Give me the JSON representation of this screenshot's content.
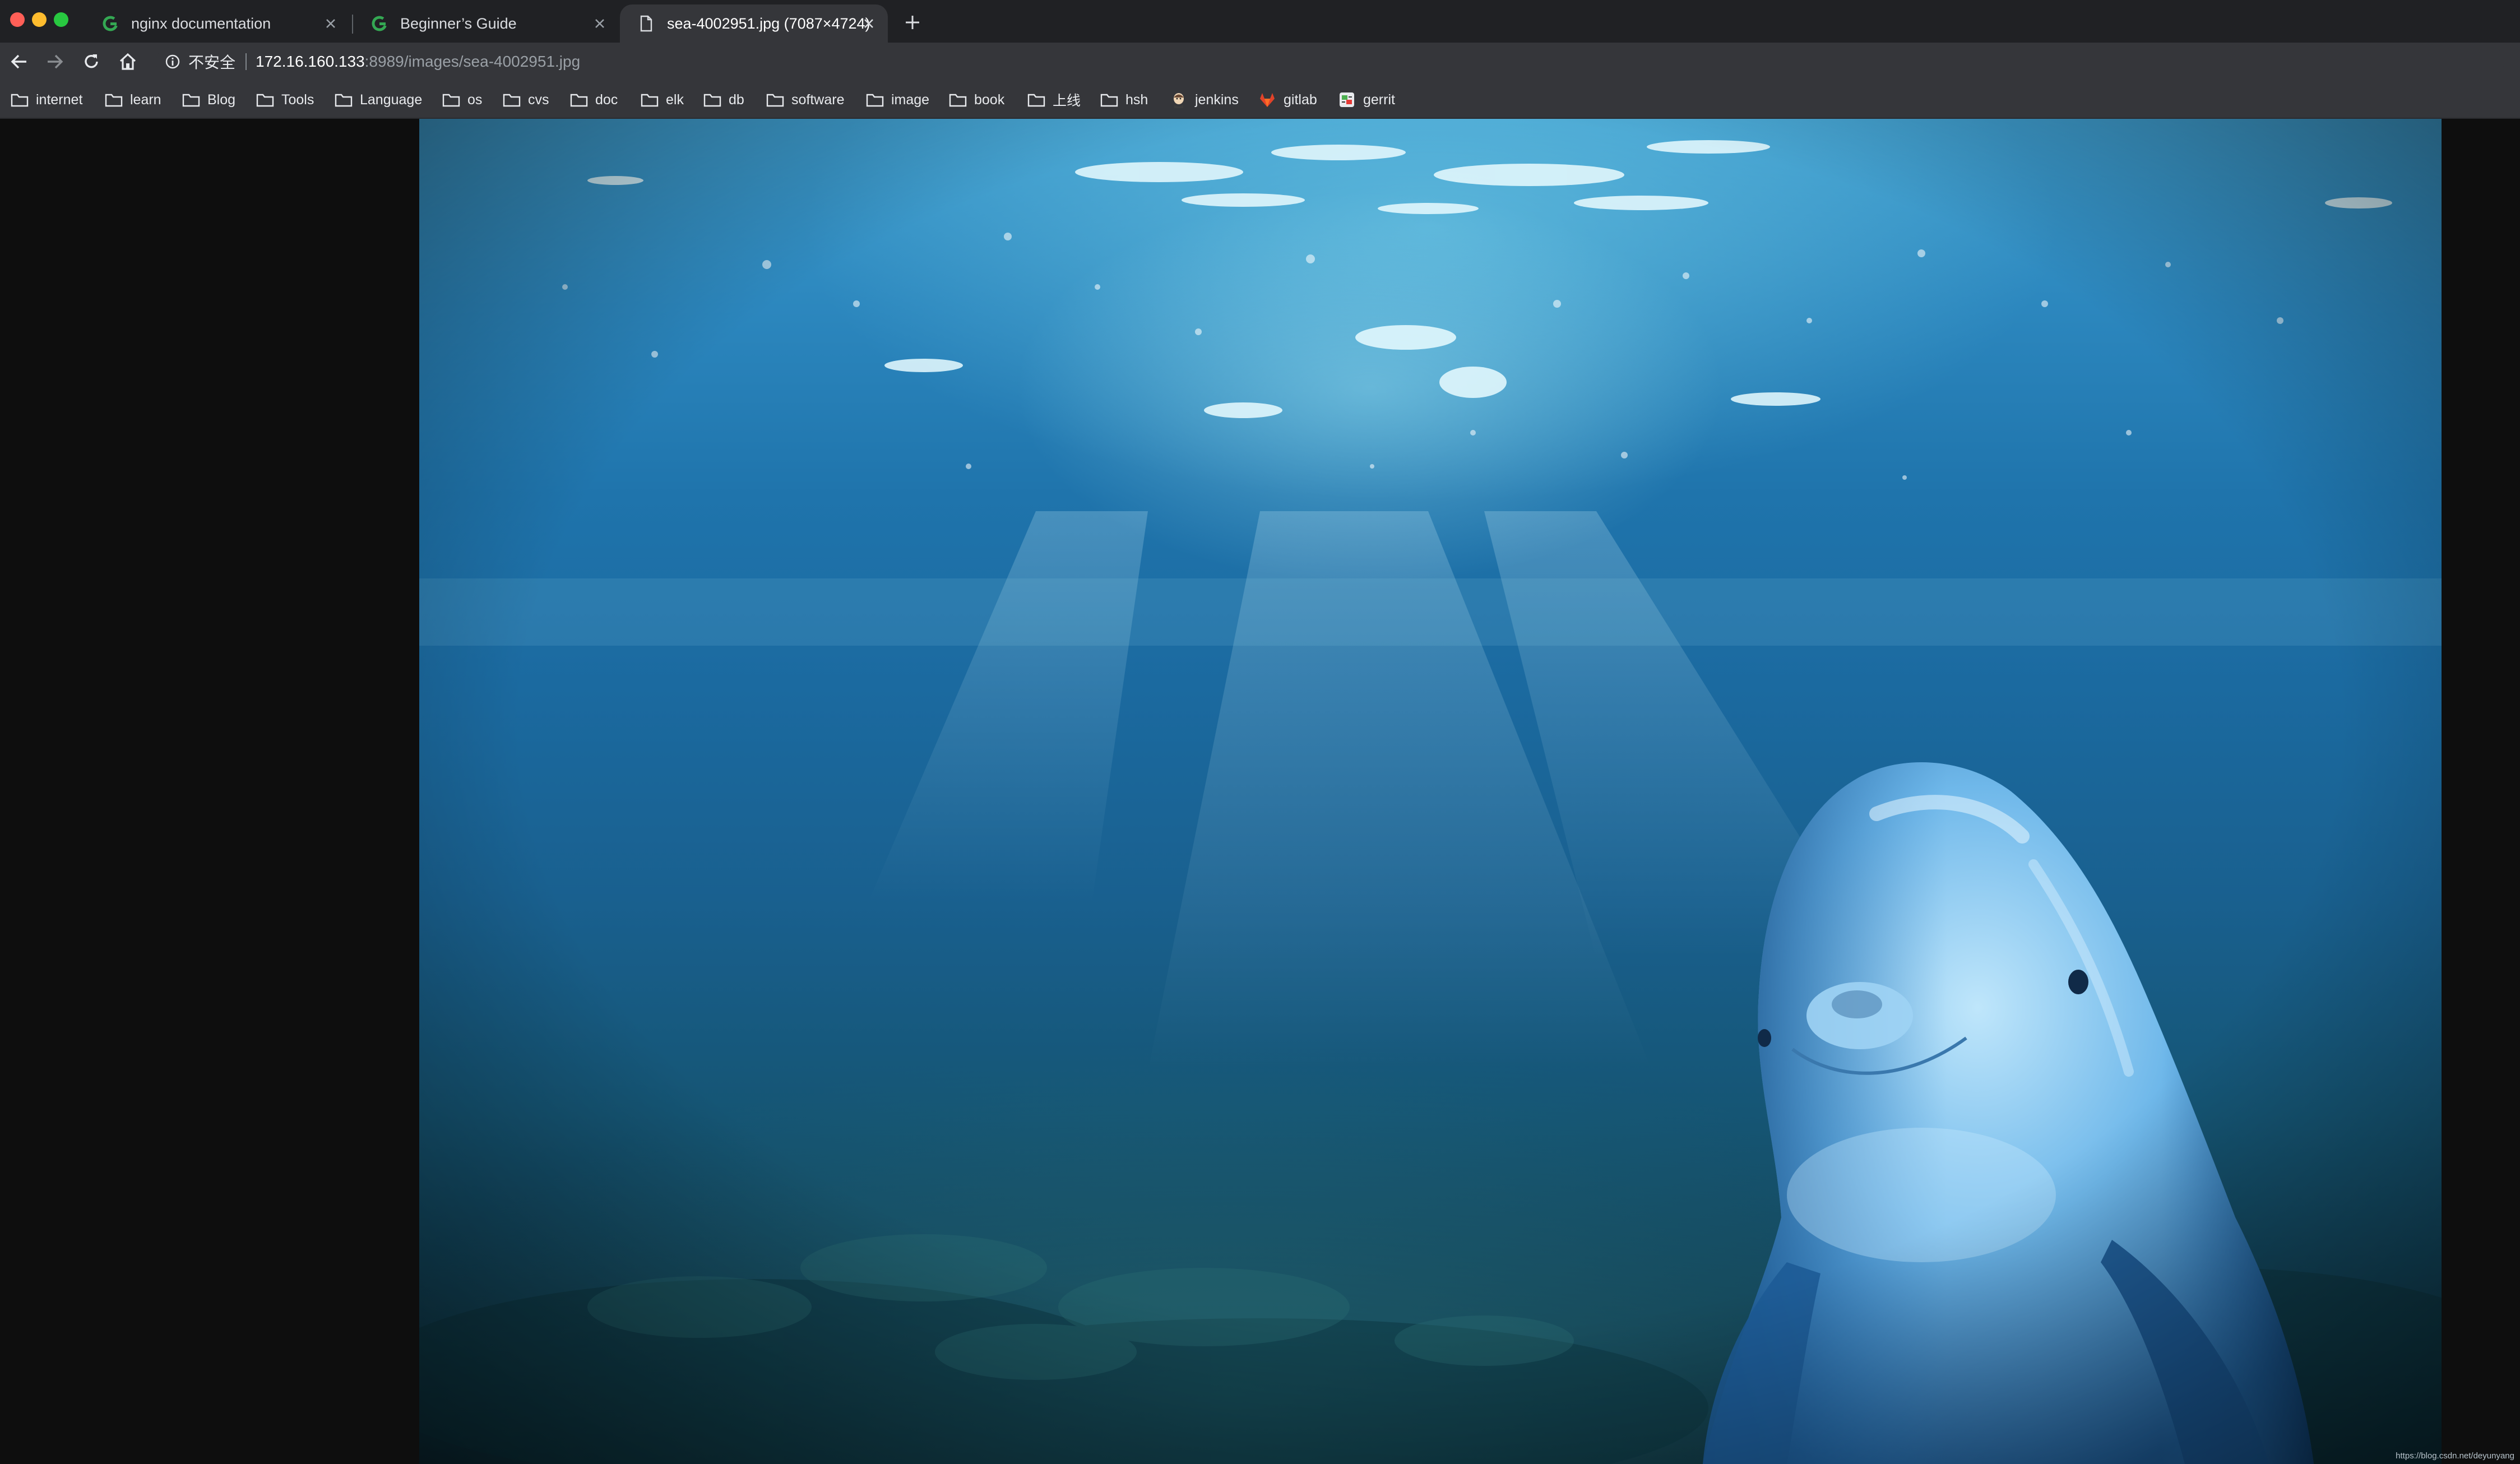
{
  "tabs": [
    {
      "title": "nginx documentation",
      "icon": "green-g-favicon",
      "active": false
    },
    {
      "title": "Beginner’s Guide",
      "icon": "green-g-favicon",
      "active": false
    },
    {
      "title": "sea-4002951.jpg (7087×4724)",
      "icon": "page-icon",
      "active": true
    }
  ],
  "address": {
    "security_label": "不安全",
    "host": "172.16.160.133",
    "path": ":8989/images/sea-4002951.jpg"
  },
  "bookmarks": [
    {
      "label": "internet",
      "icon": "folder-icon"
    },
    {
      "label": "learn",
      "icon": "folder-icon"
    },
    {
      "label": "Blog",
      "icon": "folder-icon"
    },
    {
      "label": "Tools",
      "icon": "folder-icon"
    },
    {
      "label": "Language",
      "icon": "folder-icon"
    },
    {
      "label": "os",
      "icon": "folder-icon"
    },
    {
      "label": "cvs",
      "icon": "folder-icon"
    },
    {
      "label": "doc",
      "icon": "folder-icon"
    },
    {
      "label": "elk",
      "icon": "folder-icon"
    },
    {
      "label": "db",
      "icon": "folder-icon"
    },
    {
      "label": "software",
      "icon": "folder-icon"
    },
    {
      "label": "image",
      "icon": "folder-icon"
    },
    {
      "label": "book",
      "icon": "folder-icon"
    },
    {
      "label": "上线",
      "icon": "folder-icon"
    },
    {
      "label": "hsh",
      "icon": "folder-icon"
    },
    {
      "label": "jenkins",
      "icon": "jenkins-icon"
    },
    {
      "label": "gitlab",
      "icon": "gitlab-icon"
    },
    {
      "label": "gerrit",
      "icon": "gerrit-icon"
    }
  ],
  "content": {
    "image_name": "sea-4002951.jpg",
    "watermark": "https://blog.csdn.net/deyunyang"
  },
  "colors": {
    "tabstrip_bg": "#202124",
    "toolbar_bg": "#35363a",
    "page_bg": "#0e0e0e",
    "favicon_green": "#34a853",
    "gitlab_orange": "#e24329"
  }
}
